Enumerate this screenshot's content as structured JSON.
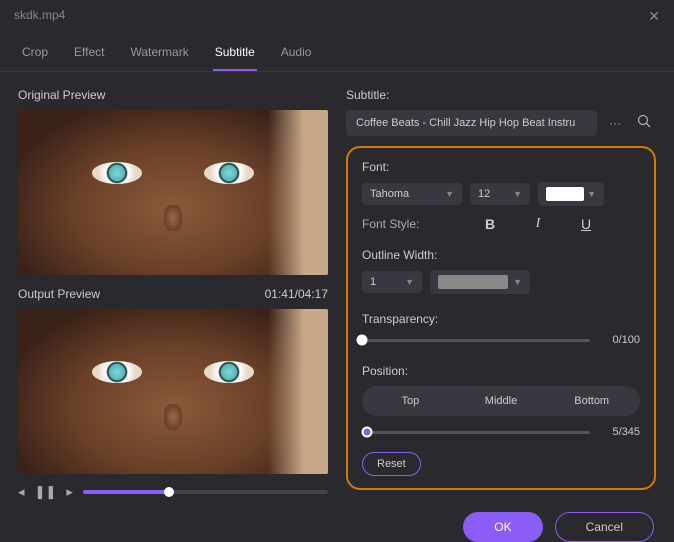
{
  "window": {
    "title": "skdk.mp4"
  },
  "tabs": {
    "crop": "Crop",
    "effect": "Effect",
    "watermark": "Watermark",
    "subtitle": "Subtitle",
    "audio": "Audio"
  },
  "left": {
    "original_label": "Original Preview",
    "output_label": "Output Preview",
    "timecode": "01:41/04:17"
  },
  "subtitle": {
    "label": "Subtitle:",
    "value": "Coffee Beats - Chill Jazz Hip Hop Beat Instru",
    "more": "···"
  },
  "font": {
    "label": "Font:",
    "family": "Tahoma",
    "size": "12",
    "style_label": "Font Style:",
    "bold": "B",
    "italic": "I",
    "underline": "U"
  },
  "outline": {
    "label": "Outline Width:",
    "width": "1"
  },
  "transparency": {
    "label": "Transparency:",
    "value": "0/100"
  },
  "position": {
    "label": "Position:",
    "top": "Top",
    "middle": "Middle",
    "bottom": "Bottom",
    "value": "5/345"
  },
  "buttons": {
    "reset": "Reset",
    "ok": "OK",
    "cancel": "Cancel"
  }
}
